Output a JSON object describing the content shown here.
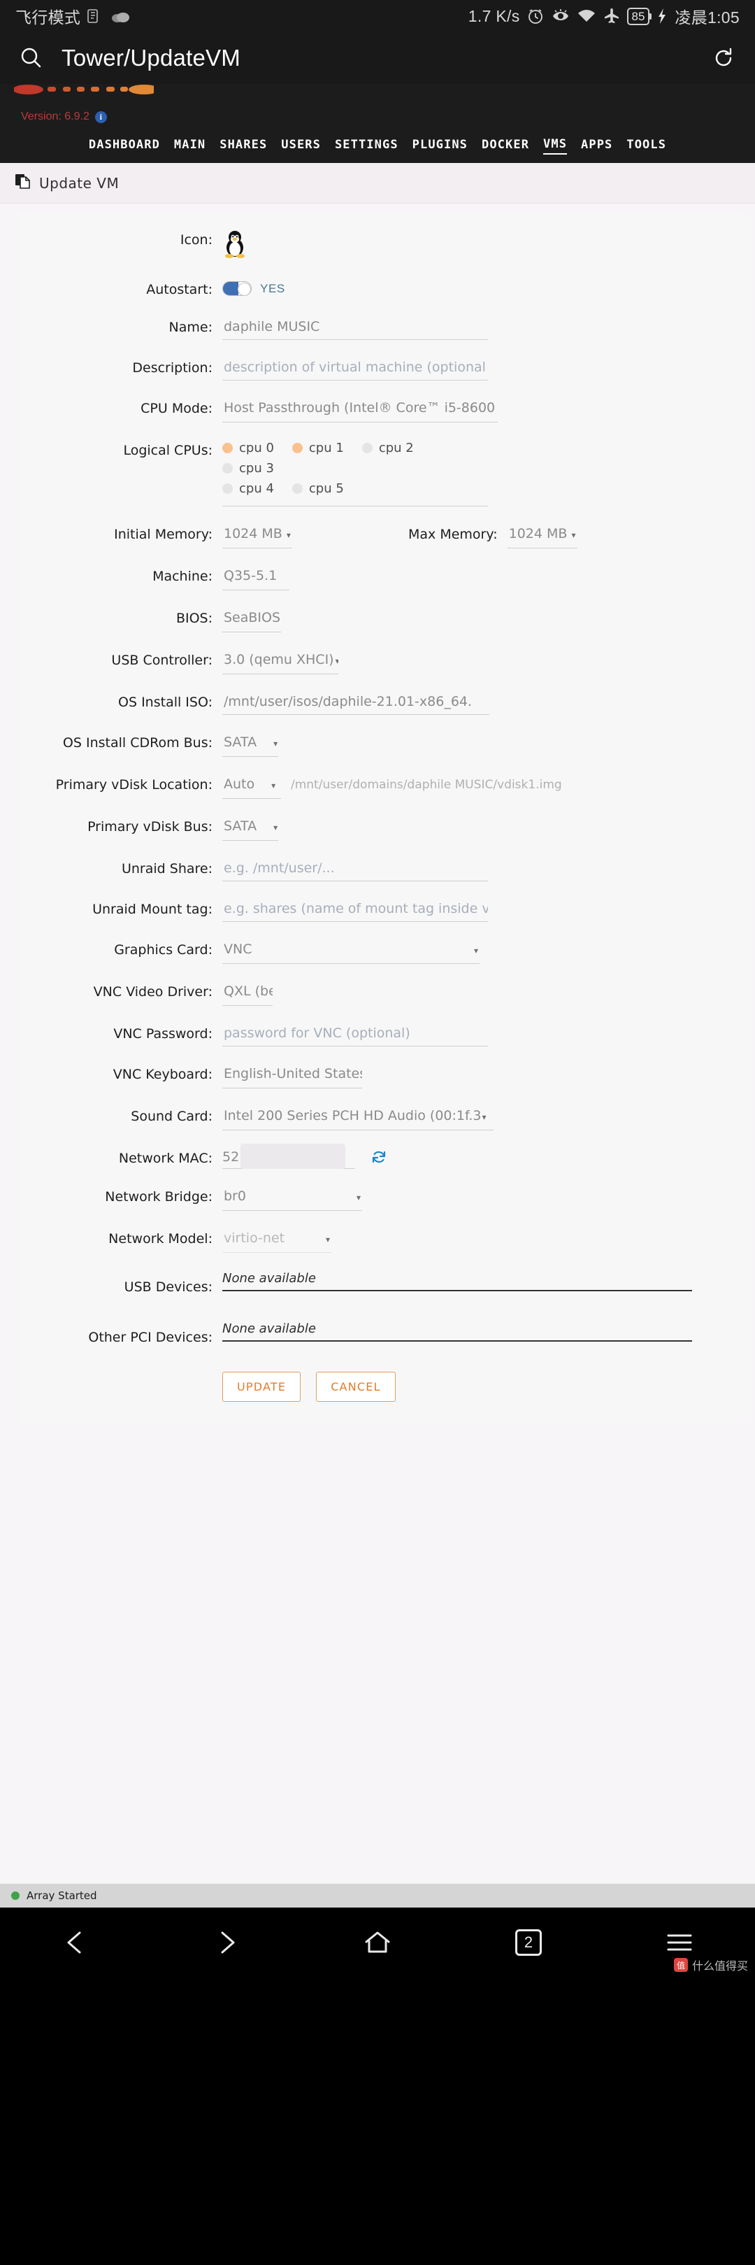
{
  "status_bar": {
    "carrier": "飞行模式",
    "network_speed": "1.7 K/s",
    "battery": "85",
    "time": "凌晨1:05",
    "icons": [
      "document-icon",
      "cloud-icon",
      "alarm-icon",
      "eye-icon",
      "wifi-icon",
      "airplane-icon",
      "battery-icon",
      "charging-icon"
    ]
  },
  "app_header": {
    "title": "Tower/UpdateVM",
    "search_icon": "search-icon",
    "reload_icon": "reload-icon"
  },
  "unraid_header": {
    "version_label": "Version: 6.9.2",
    "info_icon": "info-icon",
    "tabs": [
      {
        "label": "DASHBOARD",
        "active": false
      },
      {
        "label": "MAIN",
        "active": false
      },
      {
        "label": "SHARES",
        "active": false
      },
      {
        "label": "USERS",
        "active": false
      },
      {
        "label": "SETTINGS",
        "active": false
      },
      {
        "label": "PLUGINS",
        "active": false
      },
      {
        "label": "DOCKER",
        "active": false
      },
      {
        "label": "VMS",
        "active": true
      },
      {
        "label": "APPS",
        "active": false
      },
      {
        "label": "TOOLS",
        "active": false
      }
    ]
  },
  "page": {
    "title": "Update VM",
    "title_icon": "page-copy-icon"
  },
  "form": {
    "icon": {
      "label": "Icon:",
      "value": "tux-penguin-icon"
    },
    "autostart": {
      "label": "Autostart:",
      "state": "YES"
    },
    "name": {
      "label": "Name:",
      "value": "daphile MUSIC"
    },
    "description": {
      "label": "Description:",
      "placeholder": "description of virtual machine (optional"
    },
    "cpu_mode": {
      "label": "CPU Mode:",
      "value": "Host Passthrough (Intel® Core™ i5-8600",
      "caret": "▾"
    },
    "logical_cpus": {
      "label": "Logical CPUs:",
      "items": [
        {
          "name": "cpu 0",
          "checked": true
        },
        {
          "name": "cpu 1",
          "checked": true
        },
        {
          "name": "cpu 2",
          "checked": false
        },
        {
          "name": "cpu 3",
          "checked": false
        },
        {
          "name": "cpu 4",
          "checked": false
        },
        {
          "name": "cpu 5",
          "checked": false
        }
      ]
    },
    "initial_memory": {
      "label": "Initial Memory:",
      "value": "1024 MB",
      "caret": "▾"
    },
    "max_memory": {
      "label": "Max Memory:",
      "value": "1024 MB",
      "caret": "▾"
    },
    "machine": {
      "label": "Machine:",
      "value": "Q35-5.1",
      "caret": "▾"
    },
    "bios": {
      "label": "BIOS:",
      "value": "SeaBIOS",
      "caret": "▾"
    },
    "usb_controller": {
      "label": "USB Controller:",
      "value": "3.0 (qemu XHCI)",
      "caret": "▾"
    },
    "os_install_iso": {
      "label": "OS Install ISO:",
      "value": "/mnt/user/isos/daphile-21.01-x86_64."
    },
    "os_install_cdrom_bus": {
      "label": "OS Install CDRom Bus:",
      "value": "SATA",
      "caret": "▾"
    },
    "primary_vdisk_location": {
      "label": "Primary vDisk Location:",
      "value": "Auto",
      "caret": "▾",
      "path": "/mnt/user/domains/daphile MUSIC/vdisk1.img"
    },
    "primary_vdisk_bus": {
      "label": "Primary vDisk Bus:",
      "value": "SATA",
      "caret": "▾"
    },
    "unraid_share": {
      "label": "Unraid Share:",
      "placeholder": "e.g. /mnt/user/..."
    },
    "unraid_mount_tag": {
      "label": "Unraid Mount tag:",
      "placeholder": "e.g. shares (name of mount tag inside v"
    },
    "graphics_card": {
      "label": "Graphics Card:",
      "value": "VNC",
      "caret": "▾"
    },
    "vnc_video_driver": {
      "label": "VNC Video Driver:",
      "value": "QXL (best)",
      "caret": "▾"
    },
    "vnc_password": {
      "label": "VNC Password:",
      "placeholder": "password for VNC (optional)"
    },
    "vnc_keyboard": {
      "label": "VNC Keyboard:",
      "value": "English-United States (en-us)",
      "caret": "▾"
    },
    "sound_card": {
      "label": "Sound Card:",
      "value": "Intel 200 Series PCH HD Audio (00:1f.3",
      "caret": "▾"
    },
    "network_mac": {
      "label": "Network MAC:",
      "value": "52",
      "refresh_icon": "refresh-mac-icon"
    },
    "network_bridge": {
      "label": "Network Bridge:",
      "value": "br0",
      "caret": "▾"
    },
    "network_model": {
      "label": "Network Model:",
      "value": "virtio-net",
      "caret": "▾"
    },
    "usb_devices": {
      "label": "USB Devices:",
      "value": "None available"
    },
    "other_pci_devices": {
      "label": "Other PCI Devices:",
      "value": "None available"
    },
    "update_button": "UPDATE",
    "cancel_button": "CANCEL"
  },
  "footer": {
    "array_status": "Array Started"
  },
  "nav_bar": {
    "back_icon": "back-chevron-icon",
    "forward_icon": "forward-chevron-icon",
    "home_icon": "home-icon",
    "tab_count": "2",
    "menu_icon": "menu-icon",
    "watermark": "什么值得买"
  },
  "colors": {
    "accent_orange": "#e07c2a",
    "toggle_blue": "#3f6fb5",
    "cpu_checked": "#f9c18e",
    "array_green": "#3ea34a",
    "version_red": "#b93c3c"
  }
}
